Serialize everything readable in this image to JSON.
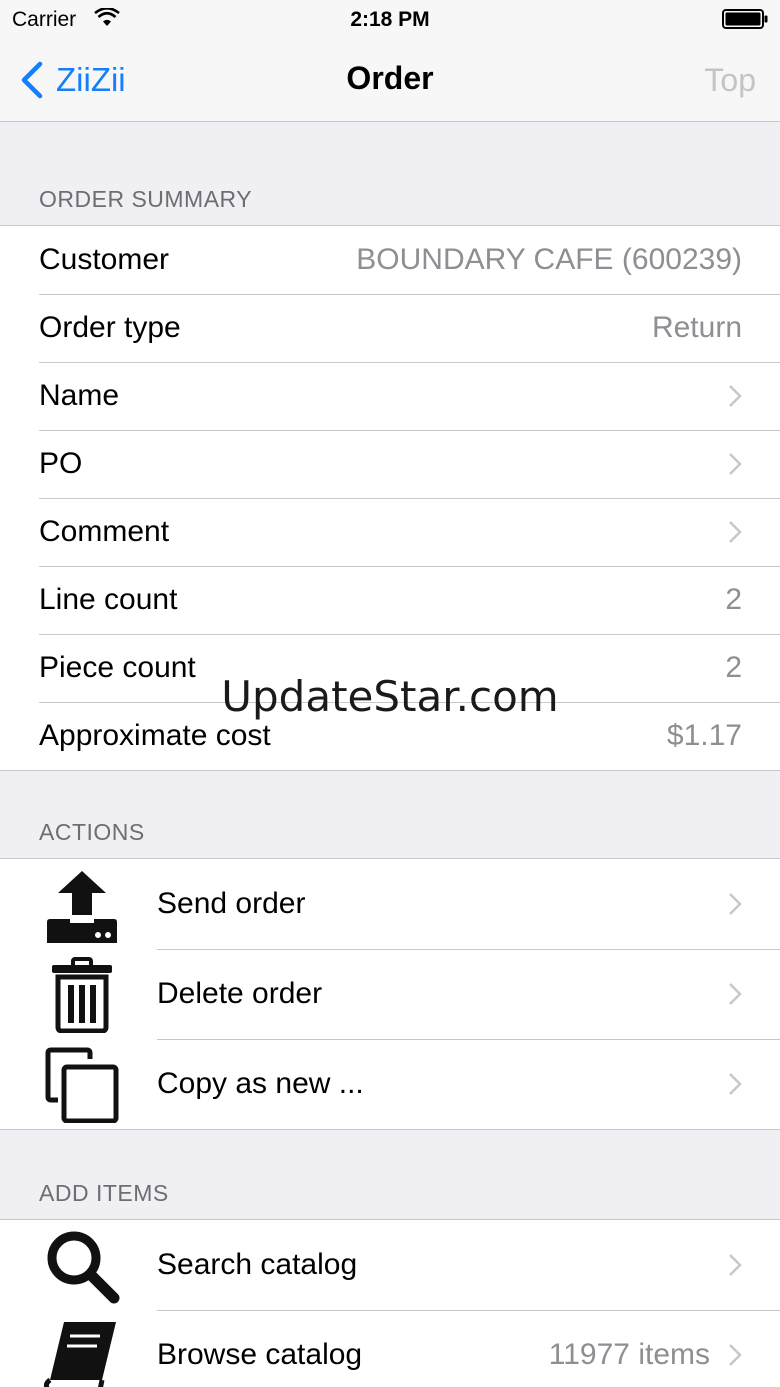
{
  "status_bar": {
    "carrier": "Carrier",
    "time": "2:18 PM"
  },
  "nav": {
    "back_label": "ZiiZii",
    "title": "Order",
    "right_label": "Top"
  },
  "order_summary": {
    "header": "ORDER SUMMARY",
    "rows": [
      {
        "label": "Customer",
        "value": "BOUNDARY CAFE (600239)"
      },
      {
        "label": "Order type",
        "value": "Return"
      },
      {
        "label": "Name",
        "value": ""
      },
      {
        "label": "PO",
        "value": ""
      },
      {
        "label": "Comment",
        "value": ""
      },
      {
        "label": "Line count",
        "value": "2"
      },
      {
        "label": "Piece count",
        "value": "2"
      },
      {
        "label": "Approximate cost",
        "value": "$1.17"
      }
    ]
  },
  "actions": {
    "header": "ACTIONS",
    "rows": [
      {
        "label": "Send order",
        "icon": "upload-icon"
      },
      {
        "label": "Delete order",
        "icon": "trash-icon"
      },
      {
        "label": "Copy as new ...",
        "icon": "copy-icon"
      }
    ]
  },
  "add_items": {
    "header": "ADD ITEMS",
    "rows": [
      {
        "label": "Search catalog",
        "value": "",
        "icon": "search-icon"
      },
      {
        "label": "Browse catalog",
        "value": "11977 items",
        "icon": "book-icon"
      }
    ]
  },
  "watermark": "UpdateStar.com",
  "colors": {
    "accent": "#157efb",
    "background": "#efeff4",
    "separator": "#c8c7cc",
    "secondary_text": "#8e8e93"
  }
}
